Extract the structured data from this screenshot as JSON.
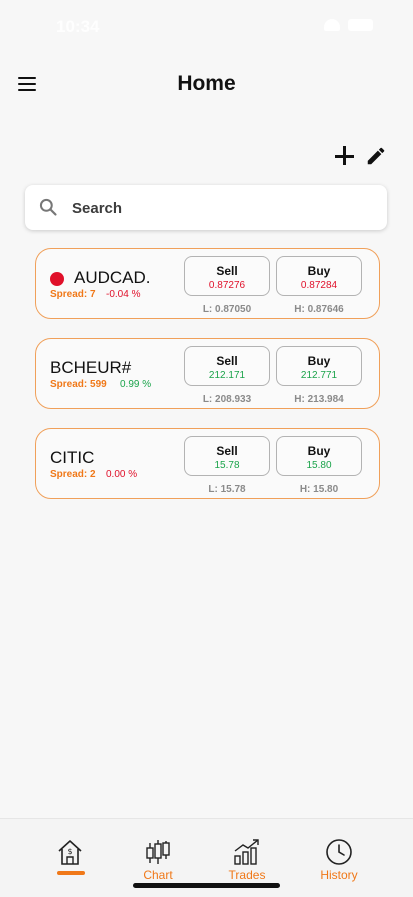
{
  "status_bar": {
    "time": "10:34"
  },
  "header": {
    "title": "Home"
  },
  "search": {
    "placeholder": "Search"
  },
  "colors": {
    "accent": "#f07818",
    "negative": "#e0102a",
    "positive": "#1aa34a",
    "card_border": "#f0a05a"
  },
  "instruments": [
    {
      "symbol": "AUDCAD.",
      "has_indicator": true,
      "spread": "Spread: 7",
      "change": "-0.04 %",
      "direction": "down",
      "sell_label": "Sell",
      "sell_price": "0.87276",
      "buy_label": "Buy",
      "buy_price": "0.87284",
      "low": "L: 0.87050",
      "high": "H: 0.87646"
    },
    {
      "symbol": "BCHEUR#",
      "has_indicator": false,
      "spread": "Spread: 599",
      "change": "0.99 %",
      "direction": "up",
      "sell_label": "Sell",
      "sell_price": "212.171",
      "buy_label": "Buy",
      "buy_price": "212.771",
      "low": "L: 208.933",
      "high": "H: 213.984"
    },
    {
      "symbol": "CITIC",
      "has_indicator": false,
      "spread": "Spread: 2",
      "change": "0.00 %",
      "direction": "up",
      "sell_label": "Sell",
      "sell_price": "15.78",
      "buy_label": "Buy",
      "buy_price": "15.80",
      "low": "L: 15.78",
      "high": "H: 15.80"
    }
  ],
  "tabbar": {
    "active": "home",
    "tabs": [
      {
        "id": "home",
        "icon": "home-dollar-icon",
        "label": ""
      },
      {
        "id": "chart",
        "icon": "candlestick-chart-icon",
        "label": "Chart"
      },
      {
        "id": "trades",
        "icon": "trades-chart-icon",
        "label": "Trades"
      },
      {
        "id": "history",
        "icon": "clock-history-icon",
        "label": "History"
      }
    ]
  }
}
